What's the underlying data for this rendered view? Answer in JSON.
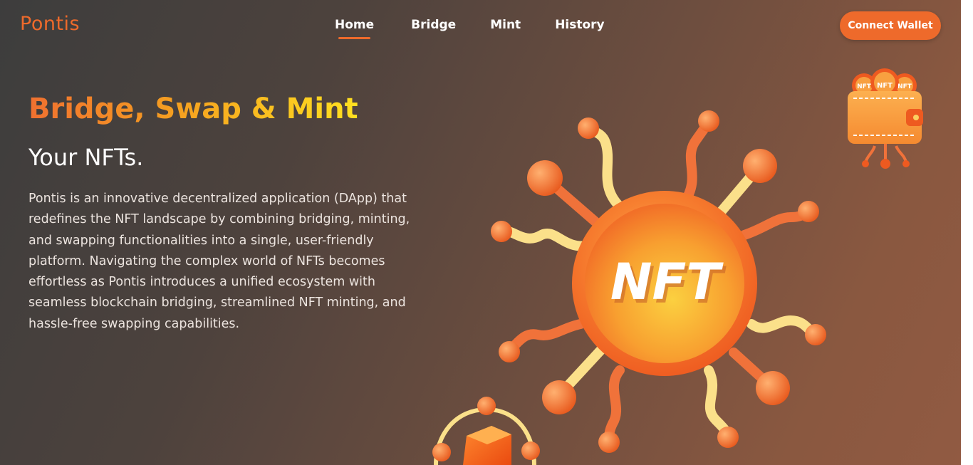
{
  "brand": {
    "logo_text": "Pontis"
  },
  "nav": {
    "items": [
      {
        "label": "Home",
        "active": true
      },
      {
        "label": "Bridge",
        "active": false
      },
      {
        "label": "Mint",
        "active": false
      },
      {
        "label": "History",
        "active": false
      }
    ]
  },
  "header": {
    "connect_label": "Connect Wallet"
  },
  "hero": {
    "title": "Bridge, Swap & Mint",
    "subtitle": "Your NFTs.",
    "description": "Pontis is an innovative decentralized application (DApp) that redefines the NFT landscape by combining bridging, minting, and swapping functionalities into a single, user-friendly platform. Navigating the complex world of NFTs becomes effortless as Pontis introduces a unified ecosystem with seamless blockchain bridging, streamlined NFT minting, and hassle-free swapping capabilities."
  },
  "illustration": {
    "coin_text": "NFT",
    "wallet_coin_texts": [
      "NFT",
      "NFT",
      "NFT"
    ],
    "icons": [
      "nft-coin-network-illustration",
      "nft-wallet-illustration",
      "blockchain-cube-illustration"
    ]
  },
  "colors": {
    "accent": "#ee6a2b",
    "title_gradient_start": "#f07030",
    "title_gradient_end": "#ffe020",
    "text": "#ffffff"
  }
}
